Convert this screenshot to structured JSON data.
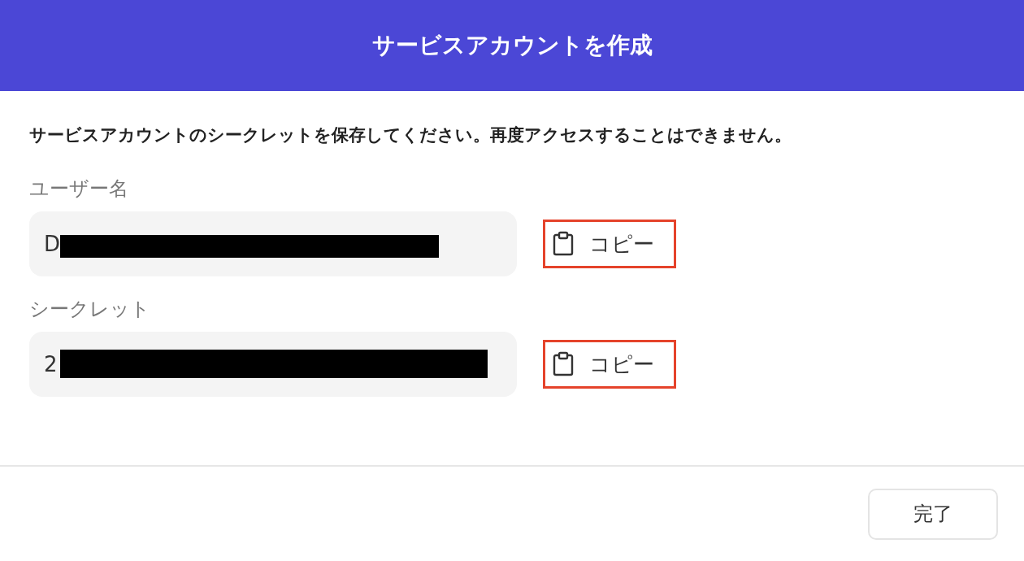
{
  "dialog": {
    "title": "サービスアカウントを作成"
  },
  "message": "サービスアカウントのシークレットを保存してください。再度アクセスすることはできません。",
  "fields": [
    {
      "label": "ユーザー名",
      "value": "D",
      "redacted": true,
      "copy_button": {
        "label": "コピー",
        "highlighted": true
      }
    },
    {
      "label": "シークレット",
      "value": "2",
      "redacted": true,
      "copy_button": {
        "label": "コピー",
        "highlighted": true
      }
    }
  ],
  "footer": {
    "button": "完了"
  }
}
